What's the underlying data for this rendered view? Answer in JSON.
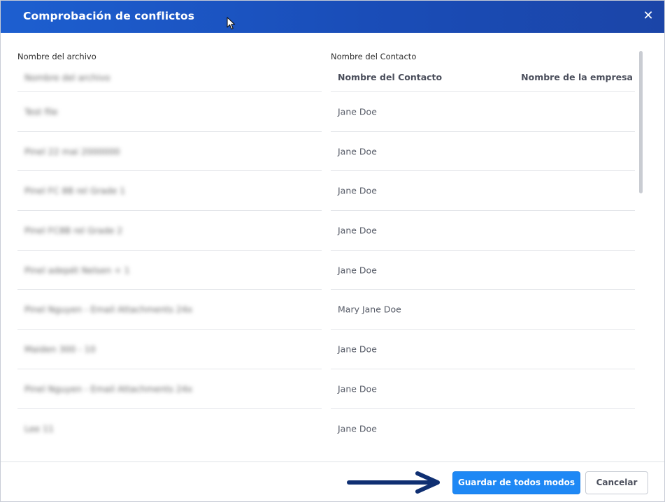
{
  "dialog": {
    "title": "Comprobación de conflictos",
    "close_icon": "close-icon"
  },
  "columns": {
    "file_label": "Nombre del archivo",
    "contact_label": "Nombre del Contacto"
  },
  "files": [
    "Nombre del archivo",
    "Test file",
    "Pinel 22 mai 2000000",
    "Pinel FC 8B rel Grade 1",
    "Pinel FC8B rel Grade 2",
    "Pinel adepét Nelsen + 1",
    "Pinel Nguyen - Email Attachments 24x",
    "Maiden 300 - 10",
    "Pinel Nguyen - Email Attachments 24x",
    "Lee 11"
  ],
  "contacts_table": {
    "headers": [
      "Nombre del Contacto",
      "Nombre de la empresa"
    ],
    "rows": [
      "Jane Doe",
      "Jane Doe",
      "Jane Doe",
      "Jane Doe",
      "Jane Doe",
      "Mary Jane Doe",
      "Jane Doe",
      "Jane Doe",
      "Jane Doe"
    ]
  },
  "footer": {
    "save_anyway_label": "Guardar de todos modos",
    "cancel_label": "Cancelar"
  },
  "colors": {
    "title_bar": "#1a4db8",
    "primary_button": "#1e88f5",
    "arrow": "#0f2f72"
  }
}
